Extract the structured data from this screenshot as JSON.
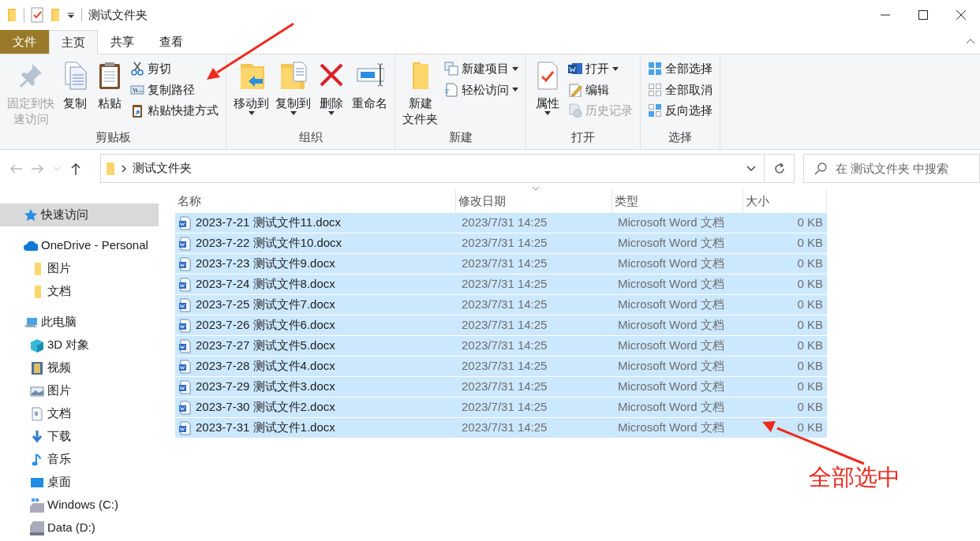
{
  "window": {
    "title": "测试文件夹"
  },
  "ribbon_tabs": [
    {
      "label": "文件",
      "kind": "file",
      "selected": false
    },
    {
      "label": "主页",
      "kind": "tab",
      "selected": true
    },
    {
      "label": "共享",
      "kind": "tab",
      "selected": false
    },
    {
      "label": "查看",
      "kind": "tab",
      "selected": false
    }
  ],
  "ribbon_groups": [
    {
      "label": "剪贴板",
      "large": [
        {
          "lines": [
            "固定到快",
            "速访问"
          ],
          "disabled": true,
          "dropdown": false
        },
        {
          "lines": [
            "复制"
          ],
          "disabled": false,
          "dropdown": false
        },
        {
          "lines": [
            "粘贴"
          ],
          "disabled": false,
          "dropdown": false
        }
      ],
      "small": [
        {
          "label": "剪切",
          "disabled": false,
          "dropdown": false
        },
        {
          "label": "复制路径",
          "disabled": false,
          "dropdown": false
        },
        {
          "label": "粘贴快捷方式",
          "disabled": false,
          "dropdown": false
        }
      ]
    },
    {
      "label": "组织",
      "large": [
        {
          "lines": [
            "移动到"
          ],
          "disabled": false,
          "dropdown": true
        },
        {
          "lines": [
            "复制到"
          ],
          "disabled": false,
          "dropdown": true
        },
        {
          "lines": [
            "删除"
          ],
          "disabled": false,
          "dropdown": true
        },
        {
          "lines": [
            "重命名"
          ],
          "disabled": false,
          "dropdown": false
        }
      ]
    },
    {
      "label": "新建",
      "large": [
        {
          "lines": [
            "新建",
            "文件夹"
          ],
          "disabled": false,
          "dropdown": false
        }
      ],
      "small": [
        {
          "label": "新建项目",
          "disabled": false,
          "dropdown": true
        },
        {
          "label": "轻松访问",
          "disabled": false,
          "dropdown": true
        }
      ]
    },
    {
      "label": "打开",
      "large": [
        {
          "lines": [
            "属性"
          ],
          "disabled": false,
          "dropdown": true
        }
      ],
      "small": [
        {
          "label": "打开",
          "disabled": false,
          "dropdown": true
        },
        {
          "label": "编辑",
          "disabled": false,
          "dropdown": false
        },
        {
          "label": "历史记录",
          "disabled": true,
          "dropdown": false
        }
      ]
    },
    {
      "label": "选择",
      "small": [
        {
          "label": "全部选择",
          "disabled": false,
          "dropdown": false
        },
        {
          "label": "全部取消",
          "disabled": false,
          "dropdown": false
        },
        {
          "label": "反向选择",
          "disabled": false,
          "dropdown": false
        }
      ]
    }
  ],
  "address_bar": {
    "path": "测试文件夹"
  },
  "search": {
    "placeholder": "在 测试文件夹 中搜索"
  },
  "sidebar": [
    {
      "label": "快速访问",
      "selected": true
    },
    {
      "label": "OneDrive - Personal",
      "selected": false,
      "children": [
        {
          "label": "图片",
          "selected": false
        },
        {
          "label": "文档",
          "selected": false
        }
      ]
    },
    {
      "label": "此电脑",
      "selected": false,
      "children": [
        {
          "label": "3D 对象",
          "selected": false
        },
        {
          "label": "视频",
          "selected": false
        },
        {
          "label": "图片",
          "selected": false
        },
        {
          "label": "文档",
          "selected": false
        },
        {
          "label": "下载",
          "selected": false
        },
        {
          "label": "音乐",
          "selected": false
        },
        {
          "label": "桌面",
          "selected": false
        },
        {
          "label": "Windows (C:)",
          "selected": false
        },
        {
          "label": "Data (D:)",
          "selected": false
        }
      ]
    }
  ],
  "table": {
    "columns": [
      "名称",
      "修改日期",
      "类型",
      "大小"
    ],
    "rows": [
      {
        "name": "2023-7-21 测试文件11.docx",
        "modified": "2023/7/31 14:25",
        "type": "Microsoft Word 文档",
        "size": "0 KB",
        "selected": true
      },
      {
        "name": "2023-7-22 测试文件10.docx",
        "modified": "2023/7/31 14:25",
        "type": "Microsoft Word 文档",
        "size": "0 KB",
        "selected": true
      },
      {
        "name": "2023-7-23 测试文件9.docx",
        "modified": "2023/7/31 14:25",
        "type": "Microsoft Word 文档",
        "size": "0 KB",
        "selected": true
      },
      {
        "name": "2023-7-24 测试文件8.docx",
        "modified": "2023/7/31 14:25",
        "type": "Microsoft Word 文档",
        "size": "0 KB",
        "selected": true
      },
      {
        "name": "2023-7-25 测试文件7.docx",
        "modified": "2023/7/31 14:25",
        "type": "Microsoft Word 文档",
        "size": "0 KB",
        "selected": true
      },
      {
        "name": "2023-7-26 测试文件6.docx",
        "modified": "2023/7/31 14:25",
        "type": "Microsoft Word 文档",
        "size": "0 KB",
        "selected": true
      },
      {
        "name": "2023-7-27 测试文件5.docx",
        "modified": "2023/7/31 14:25",
        "type": "Microsoft Word 文档",
        "size": "0 KB",
        "selected": true
      },
      {
        "name": "2023-7-28 测试文件4.docx",
        "modified": "2023/7/31 14:25",
        "type": "Microsoft Word 文档",
        "size": "0 KB",
        "selected": true
      },
      {
        "name": "2023-7-29 测试文件3.docx",
        "modified": "2023/7/31 14:25",
        "type": "Microsoft Word 文档",
        "size": "0 KB",
        "selected": true
      },
      {
        "name": "2023-7-30 测试文件2.docx",
        "modified": "2023/7/31 14:25",
        "type": "Microsoft Word 文档",
        "size": "0 KB",
        "selected": true
      },
      {
        "name": "2023-7-31 测试文件1.docx",
        "modified": "2023/7/31 14:25",
        "type": "Microsoft Word 文档",
        "size": "0 KB",
        "selected": true
      }
    ]
  },
  "annotation": {
    "label": "全部选中"
  }
}
